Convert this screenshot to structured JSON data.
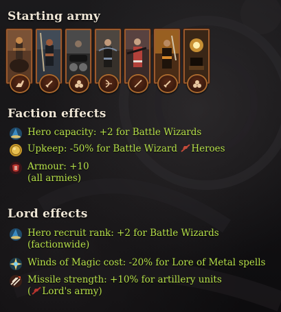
{
  "starting_army": {
    "title": "Starting army",
    "units": [
      {
        "portrait": "mounted-lord-portrait",
        "badge_icon": "cavalry-icon",
        "palette": [
          "#5a3a26",
          "#c6894a",
          "#2b1c14"
        ]
      },
      {
        "portrait": "spearmen-portrait",
        "badge_icon": "sword-icon",
        "palette": [
          "#2f3640",
          "#9a5a3a",
          "#1a1d22"
        ]
      },
      {
        "portrait": "artillery-crew-portrait",
        "badge_icon": "cannonballs-icon",
        "palette": [
          "#2a2a2a",
          "#6b6b6b",
          "#141414"
        ]
      },
      {
        "portrait": "crossbowmen-portrait",
        "badge_icon": "bow-icon",
        "palette": [
          "#36302a",
          "#7a8aa0",
          "#1c1a18"
        ]
      },
      {
        "portrait": "handgunners-portrait",
        "badge_icon": "gun-icon",
        "palette": [
          "#3a2a28",
          "#b3413a",
          "#1a1414"
        ]
      },
      {
        "portrait": "swordsmen-portrait",
        "badge_icon": "sword-icon",
        "palette": [
          "#4a2c16",
          "#d98a2c",
          "#1e130a"
        ]
      },
      {
        "portrait": "mortar-crew-portrait",
        "badge_icon": "cannonballs-icon",
        "palette": [
          "#3a2616",
          "#e0a23a",
          "#140c06"
        ]
      }
    ]
  },
  "faction_effects": {
    "title": "Faction effects",
    "items": [
      {
        "icon": "wizard-hat-icon",
        "lines": [
          "Hero capacity: +2 for Battle Wizards"
        ]
      },
      {
        "icon": "gold-coin-icon",
        "prefix": "Upkeep: -50% for Battle Wizard ",
        "inline_icon": "hero-banner-icon",
        "suffix": "Heroes"
      },
      {
        "icon": "armour-icon",
        "lines": [
          "Armour: +10",
          "(all armies)"
        ]
      }
    ]
  },
  "lord_effects": {
    "title": "Lord effects",
    "items": [
      {
        "icon": "wizard-hat-icon",
        "lines": [
          "Hero recruit rank: +2 for Battle Wizards",
          "(factionwide)"
        ]
      },
      {
        "icon": "magic-burst-icon",
        "lines": [
          "Winds of Magic cost: -20% for Lore of Metal spells"
        ]
      },
      {
        "icon": "missile-strength-icon",
        "lines": [
          "Missile strength: +10% for artillery units"
        ],
        "second_line_prefix": "(",
        "inline_icon": "lord-banner-icon",
        "second_line_suffix": "Lord's army)"
      }
    ]
  },
  "colors": {
    "effect_text": "#b6e04a",
    "heading_text": "#efe6d6",
    "card_frame": "#9a5a2e"
  }
}
